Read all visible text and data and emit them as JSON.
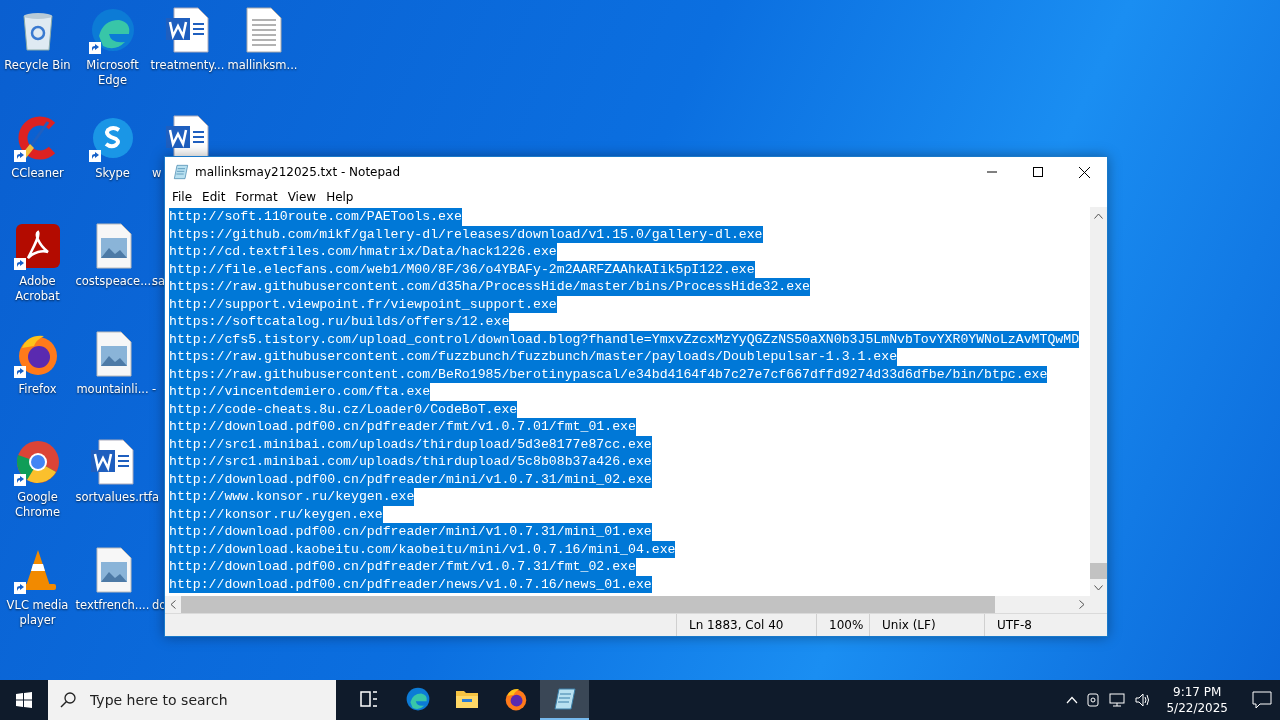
{
  "desktop": {
    "columns": [
      {
        "icons": [
          {
            "kind": "recycle",
            "label": "Recycle Bin",
            "shortcut": false
          },
          {
            "kind": "ccleaner",
            "label": "CCleaner",
            "shortcut": true
          },
          {
            "kind": "acrobat",
            "label": "Adobe Acrobat",
            "shortcut": true
          },
          {
            "kind": "firefox",
            "label": "Firefox",
            "shortcut": true
          },
          {
            "kind": "chrome",
            "label": "Google Chrome",
            "shortcut": true
          },
          {
            "kind": "vlc",
            "label": "VLC media player",
            "shortcut": true
          }
        ]
      },
      {
        "icons": [
          {
            "kind": "edge",
            "label": "Microsoft Edge",
            "shortcut": true
          },
          {
            "kind": "skype",
            "label": "Skype",
            "shortcut": true
          },
          {
            "kind": "image",
            "label": "costspeace....",
            "shortcut": false
          },
          {
            "kind": "image",
            "label": "mountainli...",
            "shortcut": false
          },
          {
            "kind": "word",
            "label": "sortvalues.rtf",
            "shortcut": false
          },
          {
            "kind": "image",
            "label": "textfrench....",
            "shortcut": false
          }
        ]
      },
      {
        "icons": [
          {
            "kind": "word",
            "label": "treatmenty...",
            "shortcut": false
          },
          {
            "kind": "word-cut",
            "label": "w",
            "shortcut": false
          },
          {
            "kind": "cut",
            "label": "sa",
            "shortcut": false
          },
          {
            "kind": "cut",
            "label": "-",
            "shortcut": false
          },
          {
            "kind": "cut",
            "label": "a",
            "shortcut": false
          },
          {
            "kind": "cut",
            "label": "do",
            "shortcut": false
          }
        ]
      },
      {
        "icons": [
          {
            "kind": "text",
            "label": "mallinksm...",
            "shortcut": false
          }
        ]
      }
    ]
  },
  "window": {
    "title": "mallinksmay212025.txt - Notepad",
    "menu": [
      "File",
      "Edit",
      "Format",
      "View",
      "Help"
    ],
    "editor": {
      "selected": true,
      "lines": [
        "http://soft.110route.com/PAETools.exe",
        "https://github.com/mikf/gallery-dl/releases/download/v1.15.0/gallery-dl.exe",
        "http://cd.textfiles.com/hmatrix/Data/hack1226.exe",
        "http://file.elecfans.com/web1/M00/8F/36/o4YBAFy-2m2AARFZAAhkAIik5pI122.exe",
        "https://raw.githubusercontent.com/d35ha/ProcessHide/master/bins/ProcessHide32.exe",
        "http://support.viewpoint.fr/viewpoint_support.exe",
        "https://softcatalog.ru/builds/offers/12.exe",
        "http://cfs5.tistory.com/upload_control/download.blog?fhandle=YmxvZzcxMzYyQGZzNS50aXN0b3J5LmNvbTovYXR0YWNoLzAvMTQwMD",
        "https://raw.githubusercontent.com/fuzzbunch/fuzzbunch/master/payloads/Doublepulsar-1.3.1.exe",
        "https://raw.githubusercontent.com/BeRo1985/berotinypascal/e34bd4164f4b7c27e7cf667dffd9274d33d6dfbe/bin/btpc.exe",
        "http://vincentdemiero.com/fta.exe",
        "http://code-cheats.8u.cz/Loader0/CodeBoT.exe",
        "http://download.pdf00.cn/pdfreader/fmt/v1.0.7.01/fmt_01.exe",
        "http://src1.minibai.com/uploads/thirdupload/5d3e8177e87cc.exe",
        "http://src1.minibai.com/uploads/thirdupload/5c8b08b37a426.exe",
        "http://download.pdf00.cn/pdfreader/mini/v1.0.7.31/mini_02.exe",
        "http://www.konsor.ru/keygen.exe",
        "http://konsor.ru/keygen.exe",
        "http://download.pdf00.cn/pdfreader/mini/v1.0.7.31/mini_01.exe",
        "http://download.kaobeitu.com/kaobeitu/mini/v1.0.7.16/mini_04.exe",
        "http://download.pdf00.cn/pdfreader/fmt/v1.0.7.31/fmt_02.exe",
        "http://download.pdf00.cn/pdfreader/news/v1.0.7.16/news_01.exe"
      ]
    },
    "status_bar": {
      "position": "Ln 1883, Col 40",
      "zoom": "100%",
      "line_ending": "Unix (LF)",
      "encoding": "UTF-8"
    }
  },
  "taskbar": {
    "search": {
      "placeholder": "Type here to search"
    },
    "apps": [
      {
        "kind": "taskview",
        "selected": false
      },
      {
        "kind": "edge",
        "selected": false
      },
      {
        "kind": "explorer",
        "selected": false
      },
      {
        "kind": "firefox",
        "selected": false
      },
      {
        "kind": "notepad",
        "selected": true
      }
    ],
    "time": "9:17 PM",
    "date": "5/22/2025"
  }
}
